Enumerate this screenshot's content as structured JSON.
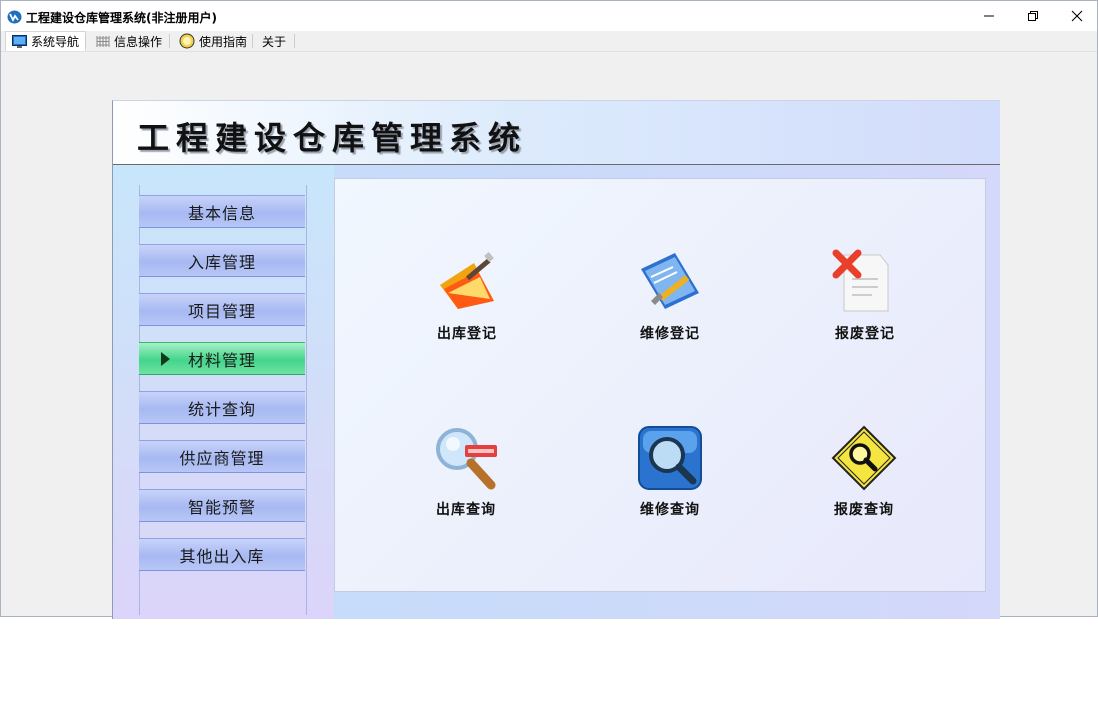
{
  "window": {
    "title": "工程建设仓库管理系统(非注册用户)"
  },
  "menu": [
    {
      "label": "系统导航",
      "icon": "monitor-icon"
    },
    {
      "label": "信息操作",
      "icon": "grid-icon"
    },
    {
      "label": "使用指南",
      "icon": "help-icon"
    },
    {
      "label": "关于",
      "icon": ""
    }
  ],
  "header": {
    "title": "工程建设仓库管理系统"
  },
  "sidebar": {
    "items": [
      {
        "label": "基本信息"
      },
      {
        "label": "入库管理"
      },
      {
        "label": "项目管理"
      },
      {
        "label": "材料管理"
      },
      {
        "label": "统计查询"
      },
      {
        "label": "供应商管理"
      },
      {
        "label": "智能预警"
      },
      {
        "label": "其他出入库"
      }
    ],
    "active_index": 3
  },
  "functions": [
    {
      "label": "出库登记",
      "icon": "folder-pen-icon"
    },
    {
      "label": "维修登记",
      "icon": "document-tools-icon"
    },
    {
      "label": "报废登记",
      "icon": "delete-document-icon"
    },
    {
      "label": "出库查询",
      "icon": "magnifier-icon"
    },
    {
      "label": "维修查询",
      "icon": "search-box-icon"
    },
    {
      "label": "报废查询",
      "icon": "diamond-search-icon"
    }
  ],
  "colors": {
    "nav_button": "#a7b9f2",
    "nav_active": "#43d58a"
  }
}
